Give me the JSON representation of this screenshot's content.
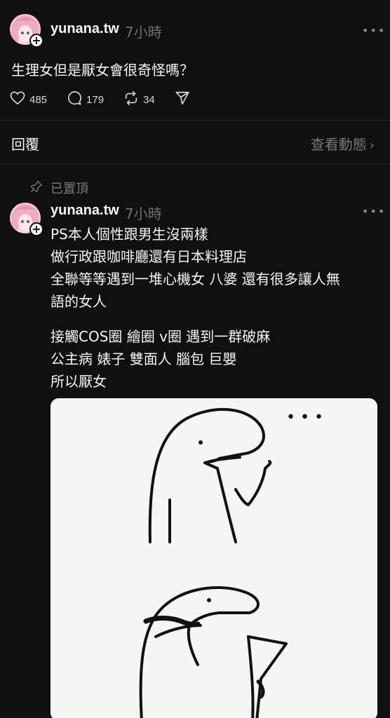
{
  "post": {
    "username": "yunana.tw",
    "time": "7小時",
    "text": "生理女但是厭女會很奇怪嗎？",
    "likes": "485",
    "comments": "179",
    "reposts": "34",
    "more": "•••"
  },
  "reply_bar": {
    "label": "回覆",
    "view_activity": "查看動態",
    "chevron": "›"
  },
  "reply": {
    "pinned_label": "已置頂",
    "username": "yunana.tw",
    "time": "7小時",
    "paragraph1": "PS本人個性跟男生沒兩樣\n做行政跟咖啡廳還有日本料理店\n全聯等等遇到一堆心機女 八婆 還有很多讓人無\n語的女人",
    "paragraph2": "接觸COS圈 繪圈 v圈 遇到一群破麻\n公主病 婊子 雙面人 腦包 巨嬰\n所以厭女",
    "more": "•••",
    "image_dots": "• • •"
  },
  "icons": {
    "like": "heart-icon",
    "comment": "comment-icon",
    "repost": "repost-icon",
    "share": "send-icon",
    "pin": "pin-icon",
    "more": "more-icon"
  },
  "colors": {
    "background": "#101010",
    "text": "#f3f5f7",
    "muted": "#6f6f6f"
  }
}
